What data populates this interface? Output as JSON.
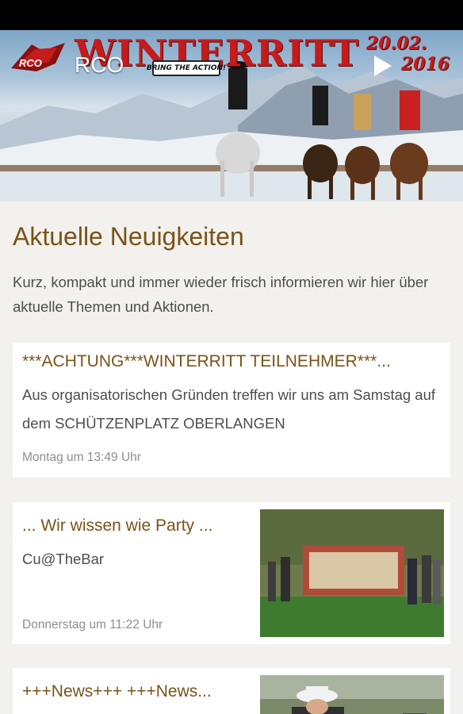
{
  "header": {
    "title": "WINTERRITT",
    "date_line1": "20.02.",
    "date_line2": "2016",
    "tagline": "BRING THE ACTION!",
    "logo_text": "RCO",
    "app_name": "RCO",
    "play_icon": "play-icon"
  },
  "page": {
    "title": "Aktuelle Neuigkeiten",
    "intro": "Kurz, kompakt und immer wieder frisch informieren wir hier über aktuelle Themen und Aktionen."
  },
  "news": [
    {
      "title": "***ACHTUNG***WINTERRITT TEILNEHMER***...",
      "text": "Aus organisatorischen Gründen treffen wir uns am Samstag auf dem SCHÜTZENPLATZ OBERLANGEN",
      "time": "Montag um 13:49 Uhr"
    },
    {
      "title": "... Wir wissen wie Party ...",
      "text": "Cu@TheBar",
      "time": "Donnerstag um 11:22 Uhr"
    },
    {
      "title": "+++News+++ +++News...",
      "text": "",
      "time": ""
    }
  ],
  "colors": {
    "accent": "#7a5318",
    "background": "#f3f1ee",
    "card": "#ffffff",
    "text": "#4d4d4d",
    "muted": "#8e8e8e",
    "brand_red": "#c61b1b"
  }
}
